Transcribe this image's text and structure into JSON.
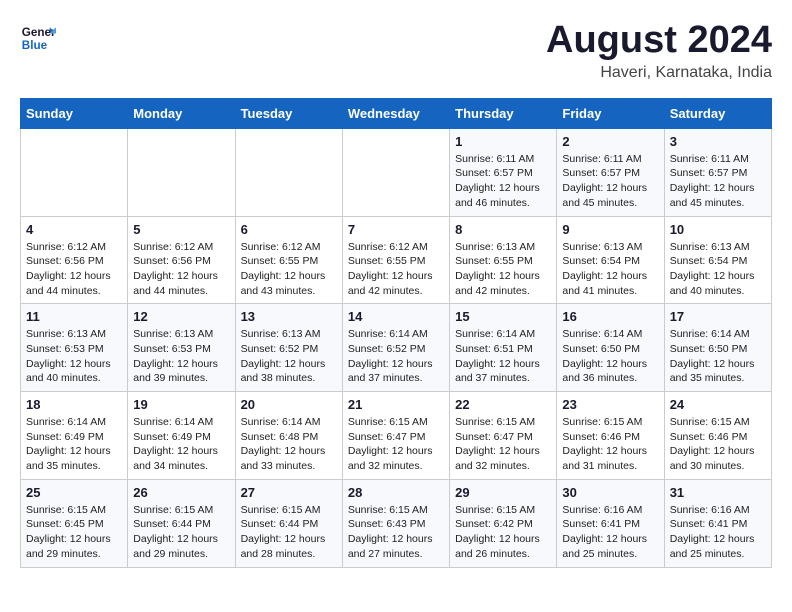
{
  "logo": {
    "text_general": "General",
    "text_blue": "Blue"
  },
  "title": "August 2024",
  "subtitle": "Haveri, Karnataka, India",
  "days_of_week": [
    "Sunday",
    "Monday",
    "Tuesday",
    "Wednesday",
    "Thursday",
    "Friday",
    "Saturday"
  ],
  "weeks": [
    [
      {
        "day": "",
        "info": ""
      },
      {
        "day": "",
        "info": ""
      },
      {
        "day": "",
        "info": ""
      },
      {
        "day": "",
        "info": ""
      },
      {
        "day": "1",
        "info": "Sunrise: 6:11 AM\nSunset: 6:57 PM\nDaylight: 12 hours and 46 minutes."
      },
      {
        "day": "2",
        "info": "Sunrise: 6:11 AM\nSunset: 6:57 PM\nDaylight: 12 hours and 45 minutes."
      },
      {
        "day": "3",
        "info": "Sunrise: 6:11 AM\nSunset: 6:57 PM\nDaylight: 12 hours and 45 minutes."
      }
    ],
    [
      {
        "day": "4",
        "info": "Sunrise: 6:12 AM\nSunset: 6:56 PM\nDaylight: 12 hours and 44 minutes."
      },
      {
        "day": "5",
        "info": "Sunrise: 6:12 AM\nSunset: 6:56 PM\nDaylight: 12 hours and 44 minutes."
      },
      {
        "day": "6",
        "info": "Sunrise: 6:12 AM\nSunset: 6:55 PM\nDaylight: 12 hours and 43 minutes."
      },
      {
        "day": "7",
        "info": "Sunrise: 6:12 AM\nSunset: 6:55 PM\nDaylight: 12 hours and 42 minutes."
      },
      {
        "day": "8",
        "info": "Sunrise: 6:13 AM\nSunset: 6:55 PM\nDaylight: 12 hours and 42 minutes."
      },
      {
        "day": "9",
        "info": "Sunrise: 6:13 AM\nSunset: 6:54 PM\nDaylight: 12 hours and 41 minutes."
      },
      {
        "day": "10",
        "info": "Sunrise: 6:13 AM\nSunset: 6:54 PM\nDaylight: 12 hours and 40 minutes."
      }
    ],
    [
      {
        "day": "11",
        "info": "Sunrise: 6:13 AM\nSunset: 6:53 PM\nDaylight: 12 hours and 40 minutes."
      },
      {
        "day": "12",
        "info": "Sunrise: 6:13 AM\nSunset: 6:53 PM\nDaylight: 12 hours and 39 minutes."
      },
      {
        "day": "13",
        "info": "Sunrise: 6:13 AM\nSunset: 6:52 PM\nDaylight: 12 hours and 38 minutes."
      },
      {
        "day": "14",
        "info": "Sunrise: 6:14 AM\nSunset: 6:52 PM\nDaylight: 12 hours and 37 minutes."
      },
      {
        "day": "15",
        "info": "Sunrise: 6:14 AM\nSunset: 6:51 PM\nDaylight: 12 hours and 37 minutes."
      },
      {
        "day": "16",
        "info": "Sunrise: 6:14 AM\nSunset: 6:50 PM\nDaylight: 12 hours and 36 minutes."
      },
      {
        "day": "17",
        "info": "Sunrise: 6:14 AM\nSunset: 6:50 PM\nDaylight: 12 hours and 35 minutes."
      }
    ],
    [
      {
        "day": "18",
        "info": "Sunrise: 6:14 AM\nSunset: 6:49 PM\nDaylight: 12 hours and 35 minutes."
      },
      {
        "day": "19",
        "info": "Sunrise: 6:14 AM\nSunset: 6:49 PM\nDaylight: 12 hours and 34 minutes."
      },
      {
        "day": "20",
        "info": "Sunrise: 6:14 AM\nSunset: 6:48 PM\nDaylight: 12 hours and 33 minutes."
      },
      {
        "day": "21",
        "info": "Sunrise: 6:15 AM\nSunset: 6:47 PM\nDaylight: 12 hours and 32 minutes."
      },
      {
        "day": "22",
        "info": "Sunrise: 6:15 AM\nSunset: 6:47 PM\nDaylight: 12 hours and 32 minutes."
      },
      {
        "day": "23",
        "info": "Sunrise: 6:15 AM\nSunset: 6:46 PM\nDaylight: 12 hours and 31 minutes."
      },
      {
        "day": "24",
        "info": "Sunrise: 6:15 AM\nSunset: 6:46 PM\nDaylight: 12 hours and 30 minutes."
      }
    ],
    [
      {
        "day": "25",
        "info": "Sunrise: 6:15 AM\nSunset: 6:45 PM\nDaylight: 12 hours and 29 minutes."
      },
      {
        "day": "26",
        "info": "Sunrise: 6:15 AM\nSunset: 6:44 PM\nDaylight: 12 hours and 29 minutes."
      },
      {
        "day": "27",
        "info": "Sunrise: 6:15 AM\nSunset: 6:44 PM\nDaylight: 12 hours and 28 minutes."
      },
      {
        "day": "28",
        "info": "Sunrise: 6:15 AM\nSunset: 6:43 PM\nDaylight: 12 hours and 27 minutes."
      },
      {
        "day": "29",
        "info": "Sunrise: 6:15 AM\nSunset: 6:42 PM\nDaylight: 12 hours and 26 minutes."
      },
      {
        "day": "30",
        "info": "Sunrise: 6:16 AM\nSunset: 6:41 PM\nDaylight: 12 hours and 25 minutes."
      },
      {
        "day": "31",
        "info": "Sunrise: 6:16 AM\nSunset: 6:41 PM\nDaylight: 12 hours and 25 minutes."
      }
    ]
  ]
}
